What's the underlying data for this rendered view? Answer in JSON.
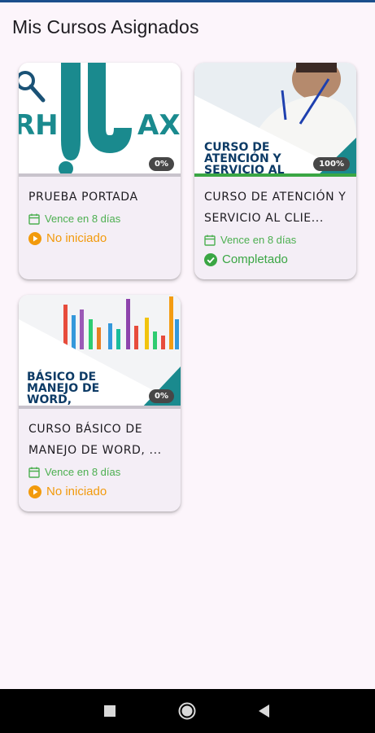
{
  "header": {
    "title": "Mis Cursos Asignados"
  },
  "colors": {
    "pending": "#f29a0c",
    "completed": "#3aa644",
    "due": "#4caf50",
    "brand_teal": "#1a8a8e",
    "brand_navy": "#0d3b66"
  },
  "courses": [
    {
      "title": "PRUEBA PORTADA",
      "due": "Vence en 8 días",
      "status": "No iniciado",
      "status_icon": "play-circle-icon",
      "progress": "0%",
      "progress_value": 0
    },
    {
      "title": "CURSO DE ATENCIÓN Y SERVICIO AL CLIE...",
      "due": "Vence en 8 días",
      "status": "Completado",
      "status_icon": "check-circle-icon",
      "progress": "100%",
      "progress_value": 100,
      "thumb_text_1": "CURSO DE",
      "thumb_text_2": "ATENCIÓN Y",
      "thumb_text_3": "SERVICIO AL"
    },
    {
      "title": "CURSO BÁSICO DE MANEJO DE WORD, ...",
      "due": "Vence en 8 días",
      "status": "No iniciado",
      "status_icon": "play-circle-icon",
      "progress": "0%",
      "progress_value": 0,
      "thumb_text_1": "BÁSICO DE",
      "thumb_text_2": "MANEJO DE",
      "thumb_text_3": "WORD,"
    }
  ],
  "navbar": {
    "buttons": [
      "recents-square-icon",
      "home-circle-icon",
      "back-triangle-icon"
    ]
  }
}
